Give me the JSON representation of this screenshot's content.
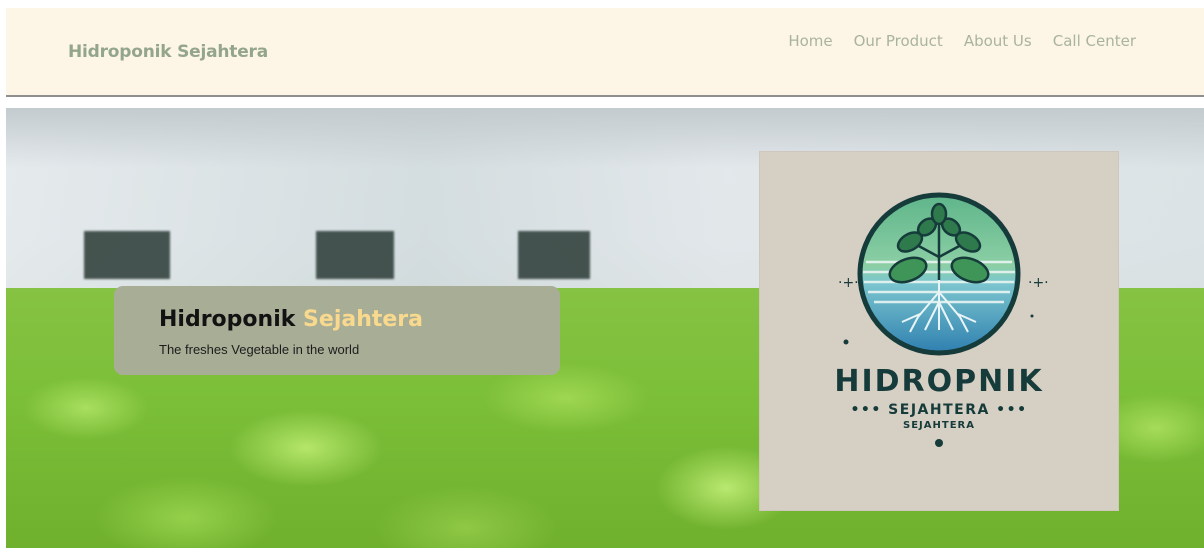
{
  "brand": "Hidroponik Sejahtera",
  "nav": {
    "items": [
      "Home",
      "Our Product",
      "About Us",
      "Call Center"
    ]
  },
  "hero": {
    "title_part1": "Hidroponik",
    "title_part2": "Sejahtera",
    "subtitle": "The freshes Vegetable in the world",
    "background": "hydroponic-lettuce-greenhouse-photo"
  },
  "logo": {
    "name": "HIDROPNIK",
    "line1": "••• SEJAHTERA •••",
    "line2": "SEJAHTERA",
    "icon": "plant-roots-water-icon"
  },
  "colors": {
    "navbar_bg": "#fdf5e6",
    "brand_text": "#93a58a",
    "nav_text": "#a9b49d",
    "tagline_box": "#a8ae96",
    "tagline_accent": "#f9d98e",
    "logo_bg": "#d6cfc4",
    "logo_text": "#153b3a"
  }
}
